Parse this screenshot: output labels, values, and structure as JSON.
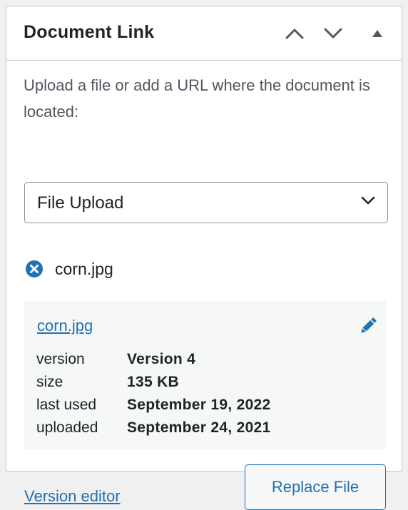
{
  "panel": {
    "title": "Document Link",
    "controls": {
      "move_up_icon": "chevron-up-icon",
      "move_down_icon": "chevron-down-icon",
      "toggle_icon": "triangle-up-icon"
    }
  },
  "upload": {
    "description": "Upload a file or add a URL where the document is located:",
    "source_select": {
      "selected": "File Upload"
    },
    "attached_file": {
      "name": "corn.jpg",
      "remove_icon": "remove-circle-icon"
    }
  },
  "file_card": {
    "link_text": "corn.jpg",
    "edit_icon": "pencil-icon",
    "meta": [
      {
        "key": "version",
        "value": "Version 4"
      },
      {
        "key": "size",
        "value": "135 KB"
      },
      {
        "key": "last used",
        "value": "September 19, 2022"
      },
      {
        "key": "uploaded",
        "value": "September 24, 2021"
      }
    ]
  },
  "footer": {
    "version_editor_link": "Version editor",
    "replace_button": "Replace File"
  },
  "colors": {
    "link": "#2271b1",
    "text": "#1d2327",
    "muted_text": "#50575e",
    "border": "#c3c4c7",
    "card_bg": "#f6f7f7"
  }
}
